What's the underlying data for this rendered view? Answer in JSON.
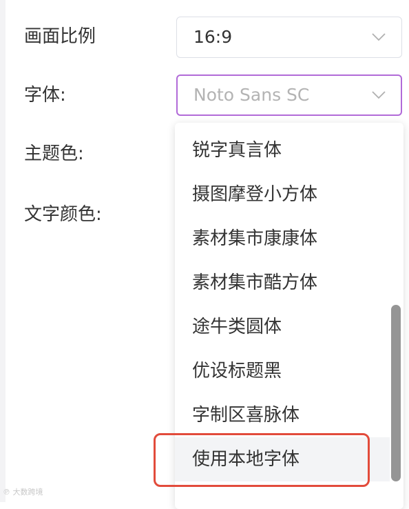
{
  "form": {
    "aspect_label": "画面比例",
    "aspect_value": "16:9",
    "font_label": "字体:",
    "font_value": "Noto Sans SC",
    "theme_color_label": "主题色:",
    "text_color_label": "文字颜色:"
  },
  "dropdown": {
    "options": [
      "锐字真言体",
      "摄图摩登小方体",
      "素材集市康康体",
      "素材集市酷方体",
      "途牛类圆体",
      "优设标题黑",
      "字制区喜脉体",
      "使用本地字体"
    ],
    "hovered_option": "使用本地字体"
  },
  "watermark": {
    "text": "大数跨境"
  },
  "icons": {
    "select_arrow": "chevron-down-icon"
  },
  "colors": {
    "focus_border": "#b16ad8",
    "annotation_highlight": "#e24b3b",
    "scrollbar": "#959595"
  }
}
